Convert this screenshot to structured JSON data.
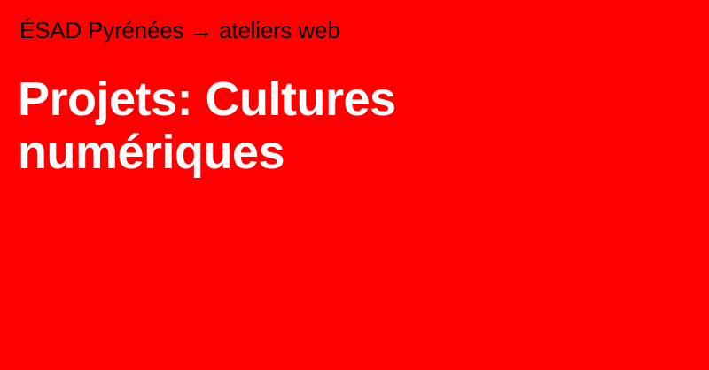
{
  "breadcrumb": {
    "site": "ÉSAD Pyrénées",
    "separator": " → ",
    "section": "ateliers web"
  },
  "title": {
    "line1": "Projets: Cultures",
    "line2": "numériques"
  },
  "colors": {
    "background": "#ff0000",
    "breadcrumb_text": "#000000",
    "title_text": "#ffffff"
  }
}
